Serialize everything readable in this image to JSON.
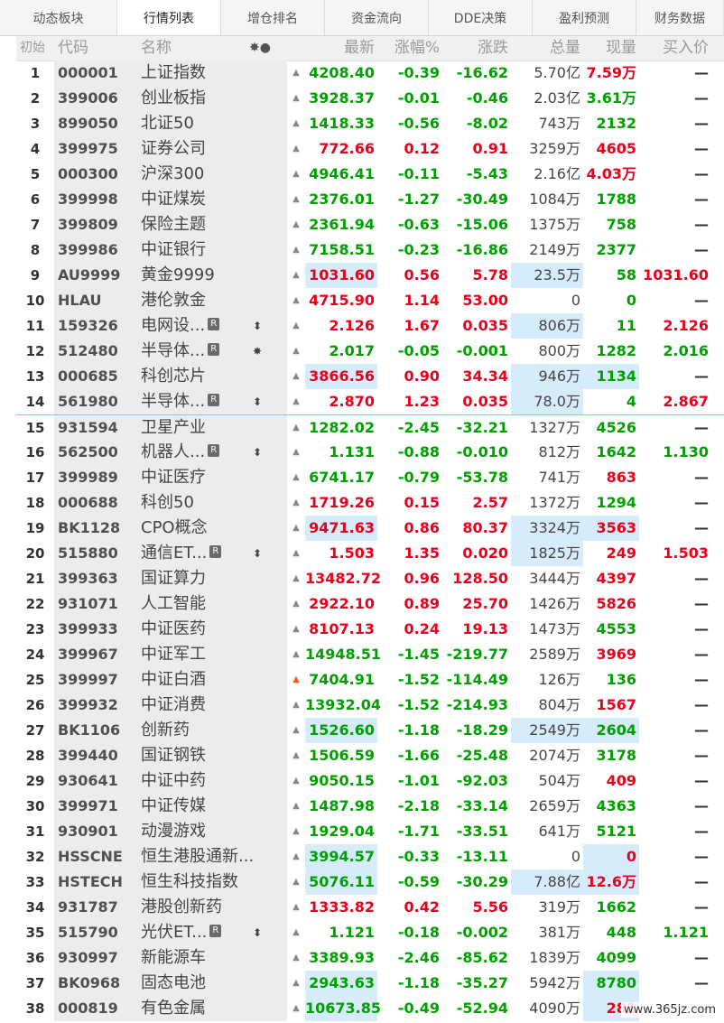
{
  "tabs": [
    "动态板块",
    "行情列表",
    "增仓排名",
    "资金流向",
    "DDE决策",
    "盈利预测",
    "财务数据"
  ],
  "header": {
    "idx": "初始",
    "code": "代码",
    "name": "名称",
    "flag": "✸●",
    "price": "最新",
    "pct": "涨幅%",
    "chg": "涨跌",
    "vol": "总量",
    "cur": "现量",
    "bid": "买入价"
  },
  "colors": {
    "up": "#e8001c",
    "down": "#00a000",
    "highlight": "#d6ecfb"
  },
  "rows": [
    {
      "i": "1",
      "code": "000001",
      "name": "上证指数",
      "price": "4208.40",
      "pct": "-0.39",
      "chg": "-16.62",
      "vol": "5.70亿",
      "cur": "7.59万",
      "bid": "—"
    },
    {
      "i": "2",
      "code": "399006",
      "name": "创业板指",
      "price": "3928.37",
      "pct": "-0.01",
      "chg": "-0.46",
      "vol": "2.03亿",
      "cur": "3.61万",
      "bid": "—"
    },
    {
      "i": "3",
      "code": "899050",
      "name": "北证50",
      "price": "1418.33",
      "pct": "-0.56",
      "chg": "-8.02",
      "vol": "743万",
      "cur": "2132",
      "bid": "—"
    },
    {
      "i": "4",
      "code": "399975",
      "name": "证券公司",
      "price": "772.66",
      "pct": "0.12",
      "chg": "0.91",
      "vol": "3259万",
      "cur": "4605",
      "bid": "—"
    },
    {
      "i": "5",
      "code": "000300",
      "name": "沪深300",
      "price": "4946.41",
      "pct": "-0.11",
      "chg": "-5.43",
      "vol": "2.16亿",
      "cur": "4.03万",
      "bid": "—"
    },
    {
      "i": "6",
      "code": "399998",
      "name": "中证煤炭",
      "price": "2376.01",
      "pct": "-1.27",
      "chg": "-30.49",
      "vol": "1084万",
      "cur": "1788",
      "bid": "—"
    },
    {
      "i": "7",
      "code": "399809",
      "name": "保险主题",
      "price": "2361.94",
      "pct": "-0.63",
      "chg": "-15.06",
      "vol": "1375万",
      "cur": "758",
      "bid": "—"
    },
    {
      "i": "8",
      "code": "399986",
      "name": "中证银行",
      "price": "7158.51",
      "pct": "-0.23",
      "chg": "-16.86",
      "vol": "2149万",
      "cur": "2377",
      "bid": "—"
    },
    {
      "i": "9",
      "code": "AU9999",
      "name": "黄金9999",
      "price": "1031.60",
      "pct": "0.56",
      "chg": "5.78",
      "vol": "23.5万",
      "cur": "58",
      "bid": "1031.60"
    },
    {
      "i": "10",
      "code": "HLAU",
      "name": "港伦敦金",
      "price": "4715.90",
      "pct": "1.14",
      "chg": "53.00",
      "vol": "0",
      "cur": "0",
      "bid": "—"
    },
    {
      "i": "11",
      "code": "159326",
      "name": "电网设...",
      "badge": "R",
      "flag": "⬍",
      "price": "2.126",
      "pct": "1.67",
      "chg": "0.035",
      "vol": "806万",
      "cur": "11",
      "bid": "2.126"
    },
    {
      "i": "12",
      "code": "512480",
      "name": "半导体...",
      "badge": "R",
      "flag": "✸",
      "price": "2.017",
      "pct": "-0.05",
      "chg": "-0.001",
      "vol": "800万",
      "cur": "1282",
      "bid": "2.016"
    },
    {
      "i": "13",
      "code": "000685",
      "name": "科创芯片",
      "price": "3866.56",
      "pct": "0.90",
      "chg": "34.34",
      "vol": "946万",
      "cur": "1134",
      "bid": "—"
    },
    {
      "i": "14",
      "code": "561980",
      "name": "半导体...",
      "badge": "R",
      "flag": "⬍",
      "price": "2.870",
      "pct": "1.23",
      "chg": "0.035",
      "vol": "78.0万",
      "cur": "4",
      "bid": "2.867"
    },
    {
      "i": "15",
      "code": "931594",
      "name": "卫星产业",
      "price": "1282.02",
      "pct": "-2.45",
      "chg": "-32.21",
      "vol": "1327万",
      "cur": "4526",
      "bid": "—"
    },
    {
      "i": "16",
      "code": "562500",
      "name": "机器人...",
      "badge": "R",
      "flag": "⬍",
      "price": "1.131",
      "pct": "-0.88",
      "chg": "-0.010",
      "vol": "812万",
      "cur": "1642",
      "bid": "1.130"
    },
    {
      "i": "17",
      "code": "399989",
      "name": "中证医疗",
      "price": "6741.17",
      "pct": "-0.79",
      "chg": "-53.78",
      "vol": "741万",
      "cur": "863",
      "bid": "—"
    },
    {
      "i": "18",
      "code": "000688",
      "name": "科创50",
      "price": "1719.26",
      "pct": "0.15",
      "chg": "2.57",
      "vol": "1372万",
      "cur": "1294",
      "bid": "—"
    },
    {
      "i": "19",
      "code": "BK1128",
      "name": "CPO概念",
      "price": "9471.63",
      "pct": "0.86",
      "chg": "80.37",
      "vol": "3324万",
      "cur": "3563",
      "bid": "—"
    },
    {
      "i": "20",
      "code": "515880",
      "name": "通信ET...",
      "badge": "R",
      "flag": "⬍",
      "price": "1.503",
      "pct": "1.35",
      "chg": "0.020",
      "vol": "1825万",
      "cur": "249",
      "bid": "1.503"
    },
    {
      "i": "21",
      "code": "399363",
      "name": "国证算力",
      "price": "13482.72",
      "pct": "0.96",
      "chg": "128.50",
      "vol": "3444万",
      "cur": "4397",
      "bid": "—"
    },
    {
      "i": "22",
      "code": "931071",
      "name": "人工智能",
      "price": "2922.10",
      "pct": "0.89",
      "chg": "25.70",
      "vol": "1426万",
      "cur": "5826",
      "bid": "—"
    },
    {
      "i": "23",
      "code": "399933",
      "name": "中证医药",
      "price": "8107.13",
      "pct": "0.24",
      "chg": "19.13",
      "vol": "1473万",
      "cur": "4553",
      "bid": "—"
    },
    {
      "i": "24",
      "code": "399967",
      "name": "中证军工",
      "price": "14948.51",
      "pct": "-1.45",
      "chg": "-219.77",
      "vol": "2589万",
      "cur": "3969",
      "bid": "—"
    },
    {
      "i": "25",
      "code": "399997",
      "name": "中证白酒",
      "price": "7404.91",
      "pct": "-1.52",
      "chg": "-114.49",
      "vol": "126万",
      "cur": "136",
      "bid": "—"
    },
    {
      "i": "26",
      "code": "399932",
      "name": "中证消费",
      "price": "13932.04",
      "pct": "-1.52",
      "chg": "-214.93",
      "vol": "804万",
      "cur": "1567",
      "bid": "—"
    },
    {
      "i": "27",
      "code": "BK1106",
      "name": "创新药",
      "price": "1526.60",
      "pct": "-1.18",
      "chg": "-18.29",
      "vol": "2549万",
      "cur": "2604",
      "bid": "—"
    },
    {
      "i": "28",
      "code": "399440",
      "name": "国证钢铁",
      "price": "1506.59",
      "pct": "-1.66",
      "chg": "-25.48",
      "vol": "2074万",
      "cur": "3178",
      "bid": "—"
    },
    {
      "i": "29",
      "code": "930641",
      "name": "中证中药",
      "price": "9050.15",
      "pct": "-1.01",
      "chg": "-92.03",
      "vol": "504万",
      "cur": "409",
      "bid": "—"
    },
    {
      "i": "30",
      "code": "399971",
      "name": "中证传媒",
      "price": "1487.98",
      "pct": "-2.18",
      "chg": "-33.14",
      "vol": "2659万",
      "cur": "4363",
      "bid": "—"
    },
    {
      "i": "31",
      "code": "930901",
      "name": "动漫游戏",
      "price": "1929.04",
      "pct": "-1.71",
      "chg": "-33.51",
      "vol": "641万",
      "cur": "5121",
      "bid": "—"
    },
    {
      "i": "32",
      "code": "HSSCNE",
      "name": "恒生港股通新...",
      "price": "3994.57",
      "pct": "-0.33",
      "chg": "-13.11",
      "vol": "0",
      "cur": "0",
      "bid": "—"
    },
    {
      "i": "33",
      "code": "HSTECH",
      "name": "恒生科技指数",
      "price": "5076.11",
      "pct": "-0.59",
      "chg": "-30.29",
      "vol": "7.88亿",
      "cur": "12.6万",
      "bid": "—"
    },
    {
      "i": "34",
      "code": "931787",
      "name": "港股创新药",
      "price": "1333.82",
      "pct": "0.42",
      "chg": "5.56",
      "vol": "319万",
      "cur": "1662",
      "bid": "—"
    },
    {
      "i": "35",
      "code": "515790",
      "name": "光伏ET...",
      "badge": "R",
      "flag": "⬍",
      "price": "1.121",
      "pct": "-0.18",
      "chg": "-0.002",
      "vol": "381万",
      "cur": "448",
      "bid": "1.121"
    },
    {
      "i": "36",
      "code": "930997",
      "name": "新能源车",
      "price": "3389.93",
      "pct": "-2.46",
      "chg": "-85.62",
      "vol": "1839万",
      "cur": "4099",
      "bid": "—"
    },
    {
      "i": "37",
      "code": "BK0968",
      "name": "固态电池",
      "price": "2943.63",
      "pct": "-1.18",
      "chg": "-35.27",
      "vol": "5942万",
      "cur": "8780",
      "bid": "—"
    },
    {
      "i": "38",
      "code": "000819",
      "name": "有色金属",
      "price": "10673.85",
      "pct": "-0.49",
      "chg": "-52.94",
      "vol": "4090万",
      "cur": "281",
      "bid": "—"
    }
  ],
  "watermark": "www.365jz.com"
}
